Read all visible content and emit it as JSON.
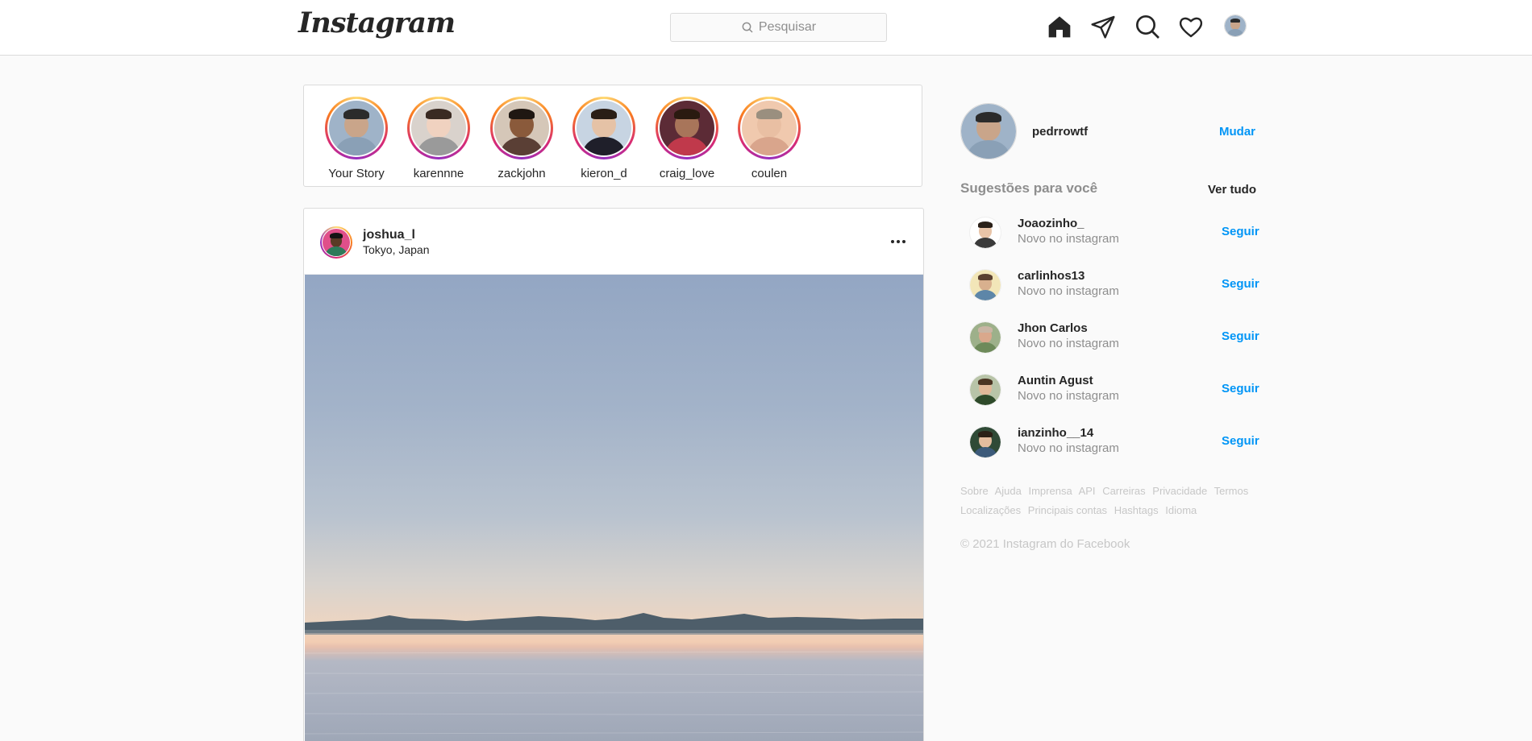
{
  "nav": {
    "logo": "Instagram",
    "search_placeholder": "Pesquisar",
    "icons": [
      "home-icon",
      "direct-icon",
      "explore-icon",
      "activity-heart-icon",
      "profile-avatar"
    ]
  },
  "stories": [
    {
      "label": "Your Story",
      "skin": "#c9a58a",
      "hair": "#2b2b2b",
      "shirt": "#8aa0b6",
      "bg": "#9fb3c8"
    },
    {
      "label": "karennne",
      "skin": "#f0d2c0",
      "hair": "#3a2a22",
      "shirt": "#9a9a9a",
      "bg": "#d9d2cc"
    },
    {
      "label": "zackjohn",
      "skin": "#8a5a3b",
      "hair": "#1f1712",
      "shirt": "#5a3f35",
      "bg": "#d5c7b8"
    },
    {
      "label": "kieron_d",
      "skin": "#e5c2a6",
      "hair": "#2a1e16",
      "shirt": "#1f1f2a",
      "bg": "#c7d4e2"
    },
    {
      "label": "craig_love",
      "skin": "#a8755a",
      "hair": "#2a1a10",
      "shirt": "#c0394b",
      "bg": "#5c2b36"
    },
    {
      "label": "coulen",
      "skin": "#e9bfa3",
      "hair": "#9a8f7f",
      "shirt": "#d9a58c",
      "bg": "#f0c9ae"
    }
  ],
  "post": {
    "username": "joshua_l",
    "location": "Tokyo, Japan",
    "avatar": {
      "skin": "#5a3a26",
      "hair": "#141414",
      "shirt": "#2d7a5a",
      "bg": "#e04f8a"
    }
  },
  "profile": {
    "username": "pedrrowtf",
    "switch_label": "Mudar",
    "avatar": {
      "skin": "#c9a58a",
      "hair": "#2b2b2b",
      "shirt": "#8aa0b6",
      "bg": "#9fb3c8"
    }
  },
  "suggestions": {
    "title": "Sugestões para você",
    "see_all": "Ver tudo",
    "follow_label": "Seguir",
    "items": [
      {
        "name": "Joaozinho_",
        "subtitle": "Novo no instagram",
        "skin": "#e8c4a8",
        "hair": "#2a2018",
        "shirt": "#3a3a3a",
        "bg": "#ffffff"
      },
      {
        "name": "carlinhos13",
        "subtitle": "Novo no instagram",
        "skin": "#d8b08e",
        "hair": "#5a4030",
        "shirt": "#5d86a8",
        "bg": "#f2e6b8"
      },
      {
        "name": "Jhon Carlos",
        "subtitle": "Novo no instagram",
        "skin": "#d9a88c",
        "hair": "#c9b5a4",
        "shirt": "#6e8a5a",
        "bg": "#9db08a"
      },
      {
        "name": "Auntin Agust",
        "subtitle": "Novo no instagram",
        "skin": "#e0b898",
        "hair": "#4a3422",
        "shirt": "#2e4a2a",
        "bg": "#b8c4a8"
      },
      {
        "name": "ianzinho__14",
        "subtitle": "Novo no instagram",
        "skin": "#e3bc9e",
        "hair": "#2b2016",
        "shirt": "#3c5a7a",
        "bg": "#2f4a36"
      }
    ]
  },
  "footer": {
    "links": [
      "Sobre",
      "Ajuda",
      "Imprensa",
      "API",
      "Carreiras",
      "Privacidade",
      "Termos",
      "Localizações",
      "Principais contas",
      "Hashtags",
      "Idioma"
    ],
    "copyright": "© 2021 Instagram do Facebook"
  },
  "colors": {
    "accent_blue": "#0095f6",
    "border": "#dbdbdb",
    "background": "#fafafa",
    "muted_text": "#8e8e8e"
  }
}
